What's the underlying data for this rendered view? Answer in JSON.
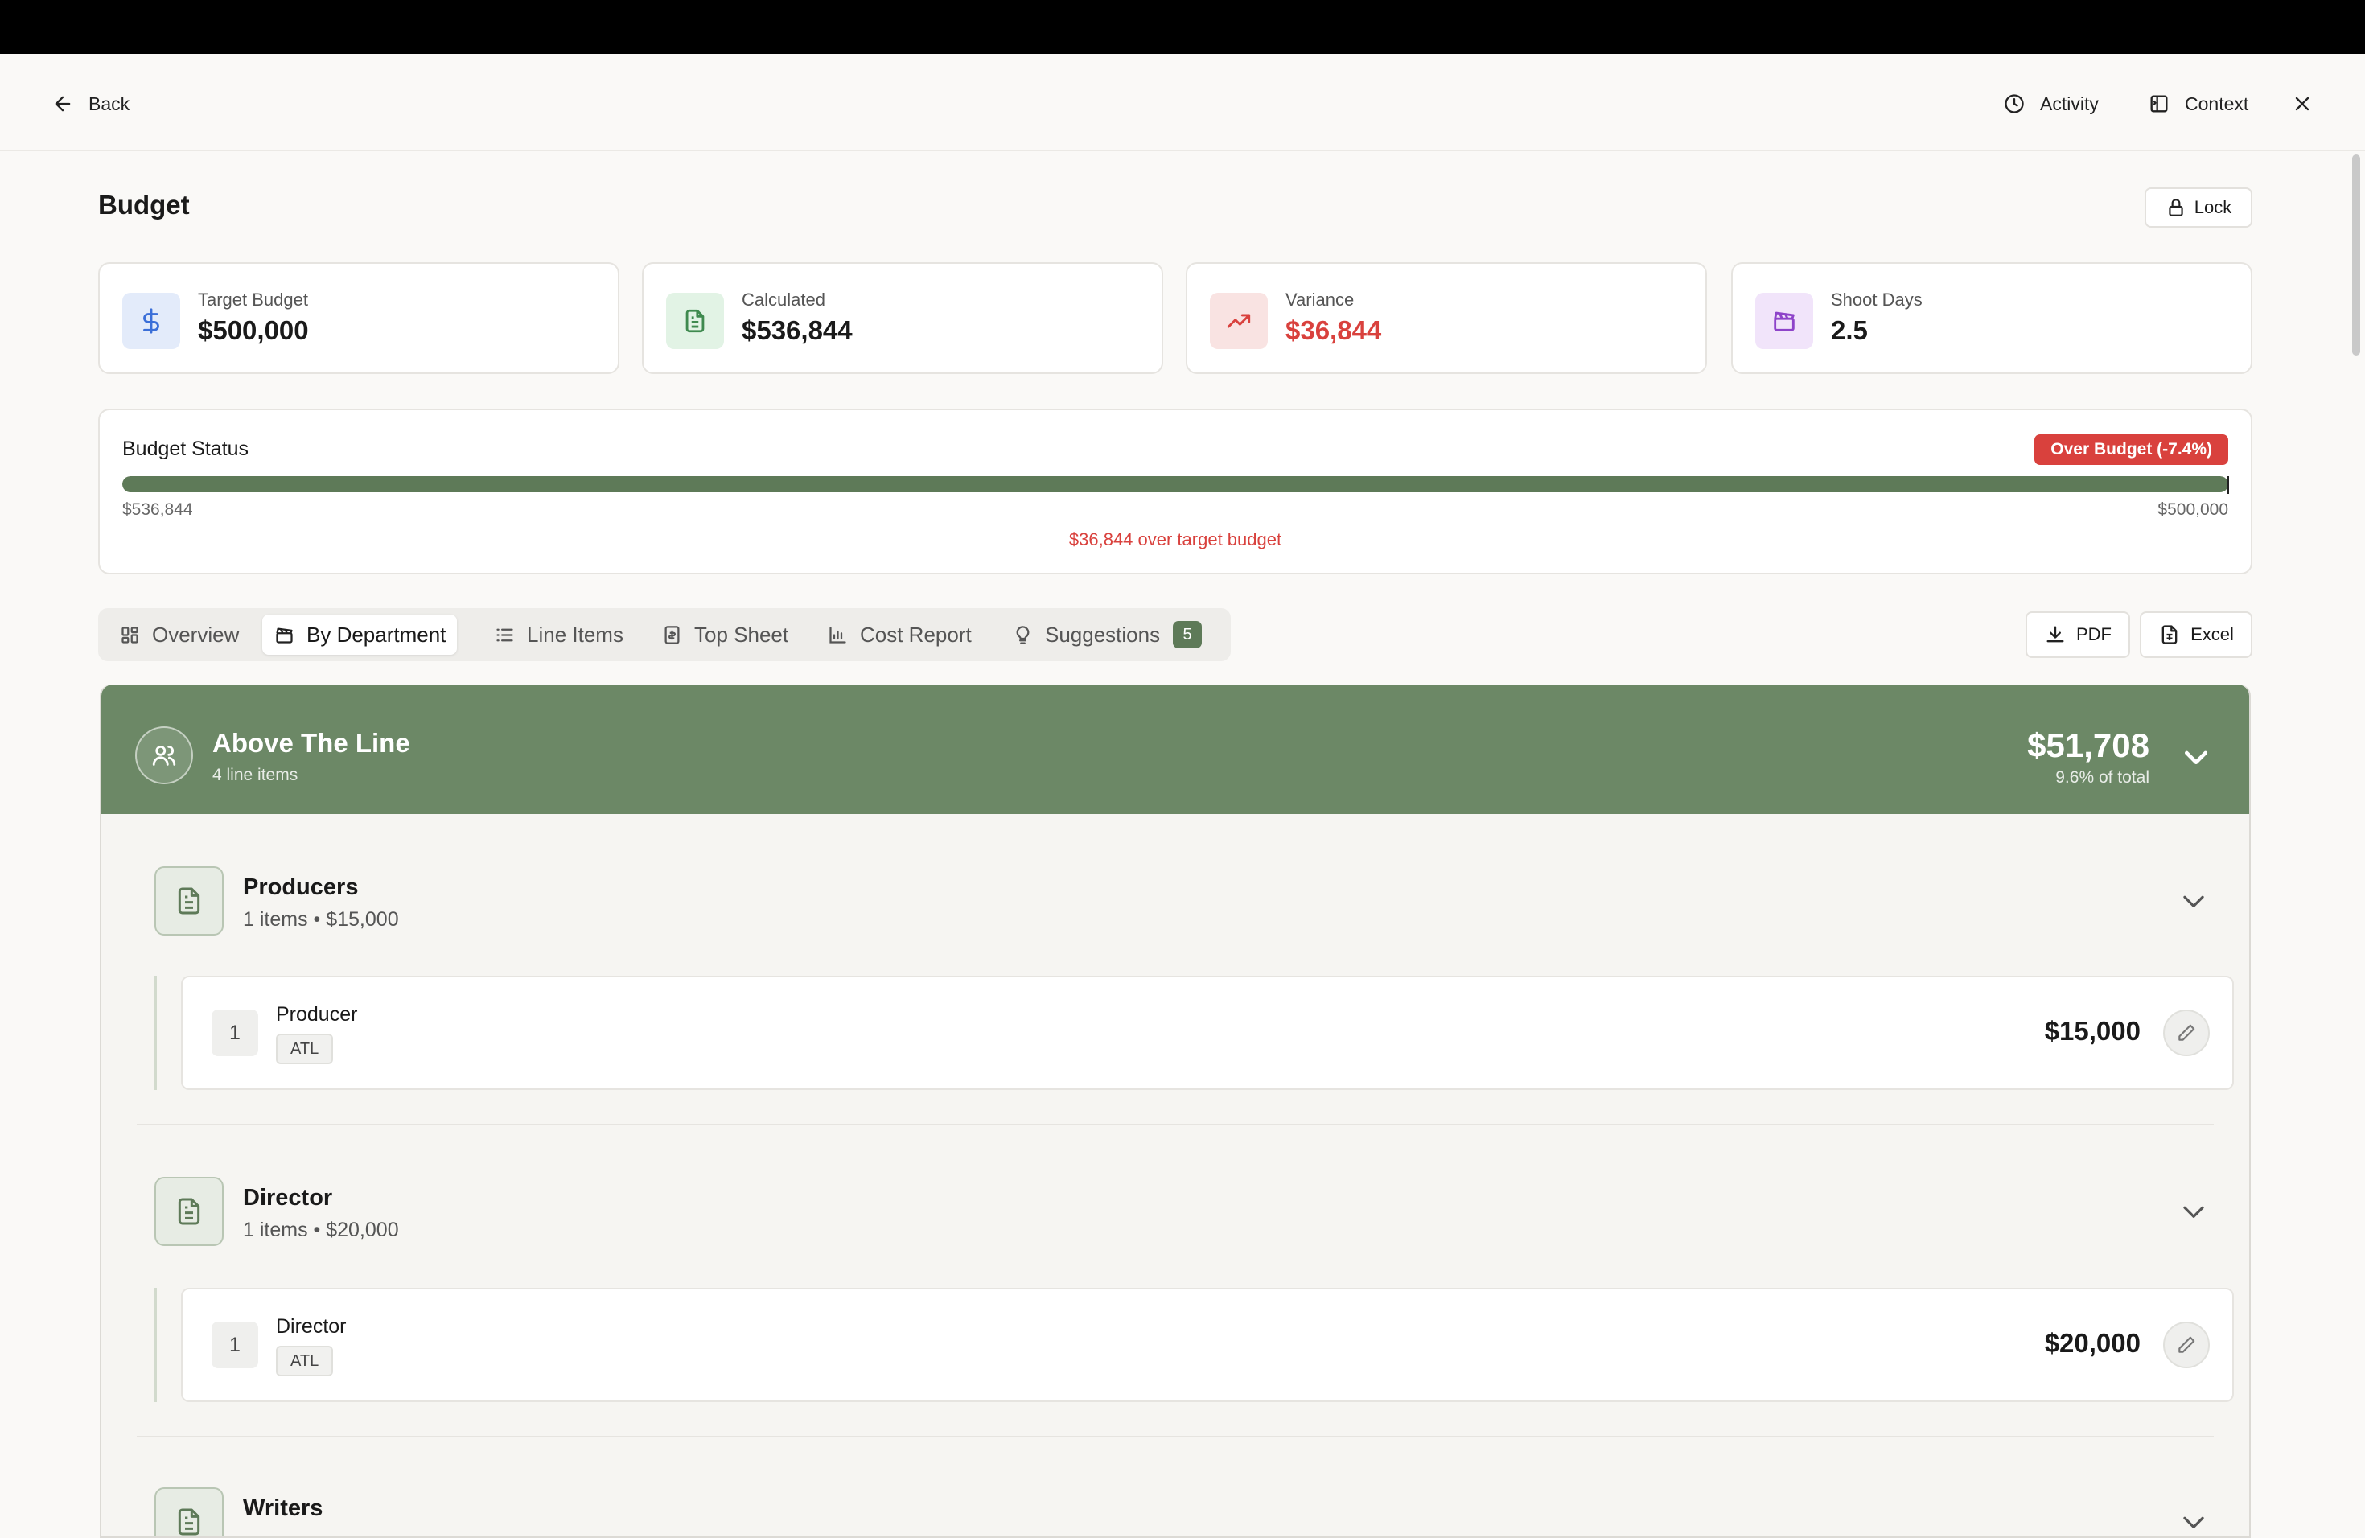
{
  "header": {
    "back_label": "Back",
    "activity_label": "Activity",
    "context_label": "Context"
  },
  "page": {
    "title": "Budget",
    "lock_label": "Lock"
  },
  "stats": [
    {
      "label": "Target Budget",
      "value": "$500,000",
      "icon": "dollar-icon",
      "color": "#3b6fd8",
      "bg": "#e3ebfa"
    },
    {
      "label": "Calculated",
      "value": "$536,844",
      "icon": "document-icon",
      "color": "#3f8a4f",
      "bg": "#e2f3e5"
    },
    {
      "label": "Variance",
      "value": "$36,844",
      "icon": "trending-up-icon",
      "color": "#d9413d",
      "bg": "#f9e3e2",
      "value_color": "#d9413d"
    },
    {
      "label": "Shoot Days",
      "value": "2.5",
      "icon": "clapperboard-icon",
      "color": "#8e44c9",
      "bg": "#f1e4fa"
    }
  ],
  "status": {
    "title": "Budget Status",
    "badge": "Over Budget (-7.4%)",
    "progress_fraction": 1.0,
    "left_value": "$536,844",
    "right_value": "$500,000",
    "over_text": "$36,844 over target budget"
  },
  "tabs": [
    {
      "label": "Overview",
      "icon": "grid-icon"
    },
    {
      "label": "By Department",
      "icon": "clapperboard-icon",
      "active": true
    },
    {
      "label": "Line Items",
      "icon": "list-icon"
    },
    {
      "label": "Top Sheet",
      "icon": "sheet-icon"
    },
    {
      "label": "Cost Report",
      "icon": "bar-chart-icon"
    },
    {
      "label": "Suggestions",
      "icon": "lightbulb-icon",
      "badge": "5"
    }
  ],
  "export": {
    "pdf_label": "PDF",
    "excel_label": "Excel"
  },
  "department": {
    "title": "Above The Line",
    "subtitle": "4 line items",
    "total": "$51,708",
    "pct": "9.6% of total",
    "groups": [
      {
        "title": "Producers",
        "meta": "1 items • $15,000",
        "line": {
          "num": "1",
          "name": "Producer",
          "tag": "ATL",
          "amount": "$15,000"
        }
      },
      {
        "title": "Director",
        "meta": "1 items • $20,000",
        "line": {
          "num": "1",
          "name": "Director",
          "tag": "ATL",
          "amount": "$20,000"
        }
      },
      {
        "title": "Writers"
      }
    ]
  },
  "colors": {
    "accent_green": "#6c8866",
    "danger": "#d9413d"
  }
}
